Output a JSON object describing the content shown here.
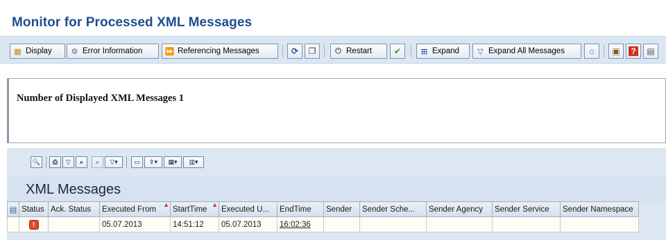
{
  "page": {
    "title": "Monitor for Processed XML Messages"
  },
  "toolbar": {
    "buttons": [
      {
        "label": "Display",
        "icon": "display-icon"
      },
      {
        "label": "Error Information",
        "icon": "error-info-icon"
      },
      {
        "label": "Referencing Messages",
        "icon": "forward-arrows-icon"
      },
      {
        "label": "Restart",
        "icon": "restart-icon"
      },
      {
        "label": "Expand",
        "icon": "expand-icon"
      },
      {
        "label": "Expand All Messages",
        "icon": "expand-all-icon"
      }
    ],
    "icon_buttons": [
      "refresh-icon",
      "copy-icon",
      "checkmark-icon",
      "collapse-icon",
      "settings-icon",
      "help-icon",
      "layout-icon"
    ]
  },
  "info": {
    "text": "Number of Displayed XML Messages 1"
  },
  "grid": {
    "title": "XML Messages",
    "toolbar_icons": [
      "details-icon",
      "print-icon",
      "filter-icon",
      "find-icon",
      "find-next-icon",
      "set-filter-icon",
      "print-preview-icon",
      "export-icon",
      "layout-icon",
      "columns-icon"
    ],
    "columns": [
      "Status",
      "Ack. Status",
      "Executed From",
      "StartTime",
      "Executed U...",
      "EndTime",
      "Sender",
      "Sender Sche...",
      "Sender Agency",
      "Sender Service",
      "Sender Namespace"
    ],
    "rows": [
      {
        "status_icon": "error-status-icon",
        "ack_status": "",
        "executed_from": "05.07.2013",
        "start_time": "14:51:12",
        "executed_until": "05.07.2013",
        "end_time": "16:02:36",
        "sender": "",
        "sender_scheme": "",
        "sender_agency": "",
        "sender_service": "",
        "sender_namespace": ""
      }
    ]
  }
}
